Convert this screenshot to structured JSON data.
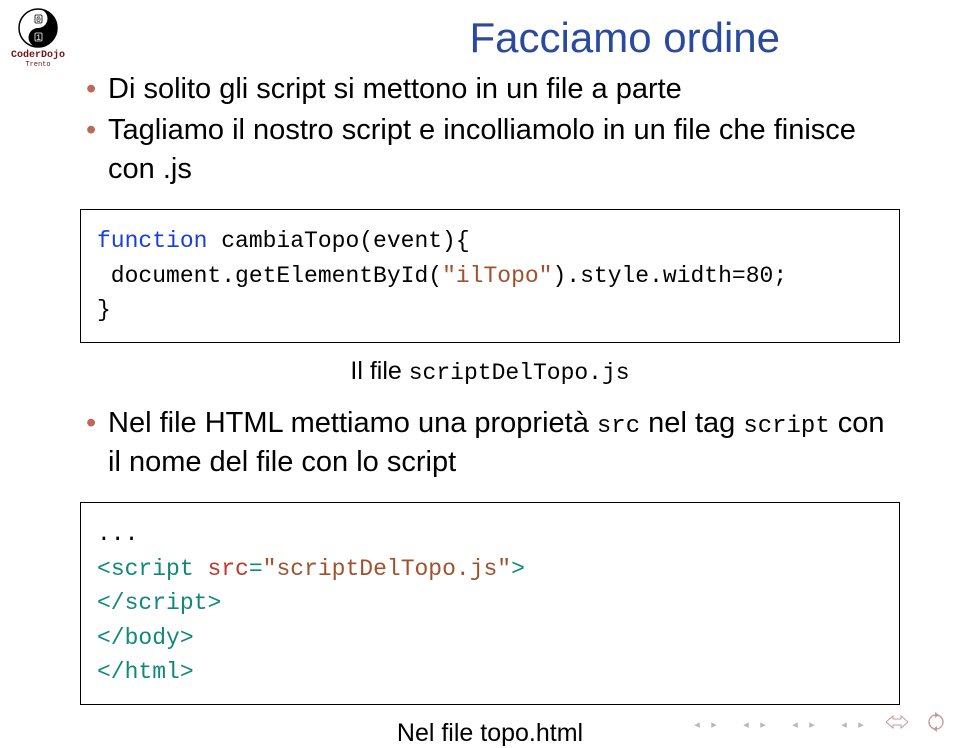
{
  "logo": {
    "digit_top": "0",
    "digit_bottom": "1",
    "name": "CoderDojo",
    "location": "Trento"
  },
  "title": "Facciamo ordine",
  "bullets_top": [
    "Di solito gli script si mettono in un file a parte",
    "Tagliamo il nostro script e incolliamolo in un file che finisce con .js"
  ],
  "code1": {
    "line1_kw": "function",
    "line1_rest": " cambiaTopo(event){",
    "line2_pre": " document.getElementById(",
    "line2_str": "\"ilTopo\"",
    "line2_post": ").style.width=80;",
    "line3": "}"
  },
  "caption1_pre": "Il file ",
  "caption1_file": "scriptDelTopo.js",
  "bullets_mid": [
    {
      "pre": "Nel file HTML mettiamo una proprietà ",
      "mono1": "src",
      "mid": " nel tag ",
      "mono2": "script",
      "post": " con il nome del file con lo script"
    }
  ],
  "code2": {
    "line1": "...",
    "line2_a": "<",
    "line2_b": "script ",
    "line2_c": "src",
    "line2_d": "=",
    "line2_e": "\"scriptDelTopo.js\"",
    "line2_f": ">",
    "line3_a": "</",
    "line3_b": "script",
    "line3_c": ">",
    "line4_a": "</",
    "line4_b": "body",
    "line4_c": ">",
    "line5_a": "</",
    "line5_b": "html",
    "line5_c": ">"
  },
  "caption2_pre": "Nel file ",
  "caption2_file": "topo.html"
}
